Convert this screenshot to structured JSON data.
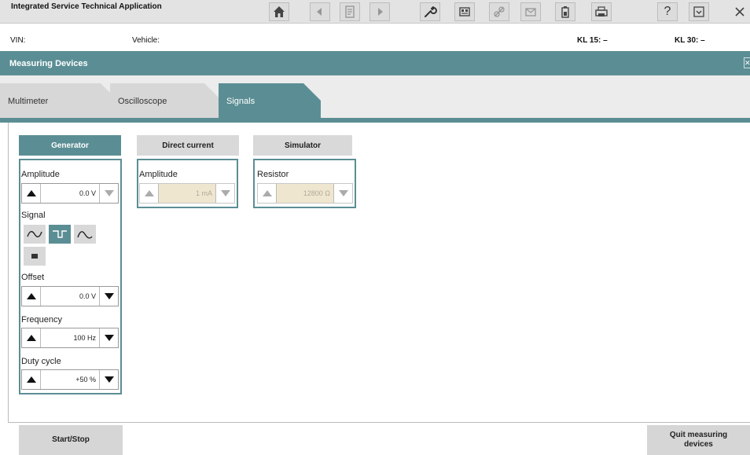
{
  "app": {
    "title": "Integrated Service Technical Application"
  },
  "toolbar": {
    "icons": [
      "home-icon",
      "arrow-left-icon",
      "document-icon",
      "arrow-right-icon",
      "wrench-icon",
      "module-icon",
      "link-icon",
      "mail-icon",
      "battery-icon",
      "print-icon",
      "help-icon",
      "minimize-icon",
      "close-icon"
    ],
    "help_label": "?"
  },
  "info": {
    "vin_label": "VIN:",
    "vehicle_label": "Vehicle:",
    "kl15": "KL 15:  –",
    "kl30": "KL 30:  –"
  },
  "section": {
    "title": "Measuring Devices"
  },
  "tabs": [
    {
      "label": "Multimeter",
      "active": false
    },
    {
      "label": "Oscilloscope",
      "active": false
    },
    {
      "label": "Signals",
      "active": true
    }
  ],
  "generator": {
    "heading": "Generator",
    "amplitude_label": "Amplitude",
    "amplitude_value": "0.0 V",
    "signal_label": "Signal",
    "signal_types": [
      "sine-wave-icon",
      "square-wave-icon",
      "triangle-wave-icon",
      "dc-signal-icon"
    ],
    "selected_signal": "square-wave-icon",
    "offset_label": "Offset",
    "offset_value": "0.0 V",
    "frequency_label": "Frequency",
    "frequency_value": "100 Hz",
    "duty_label": "Duty cycle",
    "duty_value": "+50 %"
  },
  "direct_current": {
    "heading": "Direct current",
    "amplitude_label": "Amplitude",
    "amplitude_value": "1 mA"
  },
  "simulator": {
    "heading": "Simulator",
    "resistor_label": "Resistor",
    "resistor_value": "12800 Ω"
  },
  "footer": {
    "start_stop": "Start/Stop",
    "quit": "Quit measuring devices"
  },
  "colors": {
    "accent": "#5b8e94",
    "panel_bg": "#ececec",
    "button_bg": "#d6d6d6",
    "disabled_field": "#efe6cf"
  }
}
